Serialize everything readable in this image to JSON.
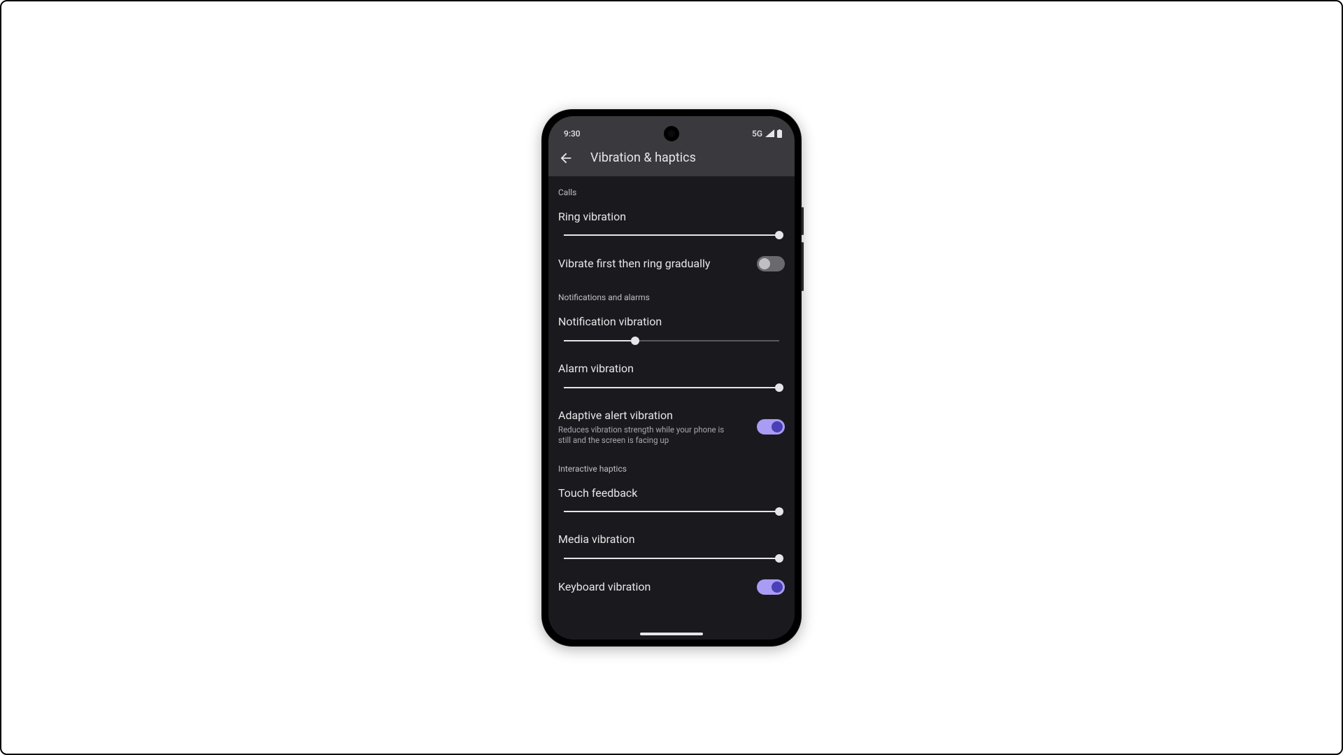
{
  "status": {
    "time": "9:30",
    "network": "5G"
  },
  "header": {
    "title": "Vibration & haptics"
  },
  "sections": {
    "calls": {
      "header": "Calls",
      "ring_vibration": {
        "label": "Ring vibration",
        "value": 100
      },
      "vibrate_first": {
        "label": "Vibrate first then ring gradually",
        "enabled": false
      }
    },
    "notifications": {
      "header": "Notifications and alarms",
      "notification_vibration": {
        "label": "Notification vibration",
        "value": 33
      },
      "alarm_vibration": {
        "label": "Alarm vibration",
        "value": 100
      },
      "adaptive": {
        "label": "Adaptive alert vibration",
        "desc": "Reduces vibration strength while your phone is still and the screen is facing up",
        "enabled": true
      }
    },
    "interactive": {
      "header": "Interactive haptics",
      "touch_feedback": {
        "label": "Touch feedback",
        "value": 100
      },
      "media_vibration": {
        "label": "Media vibration",
        "value": 100
      },
      "keyboard_vibration": {
        "label": "Keyboard vibration",
        "enabled": true
      }
    }
  }
}
